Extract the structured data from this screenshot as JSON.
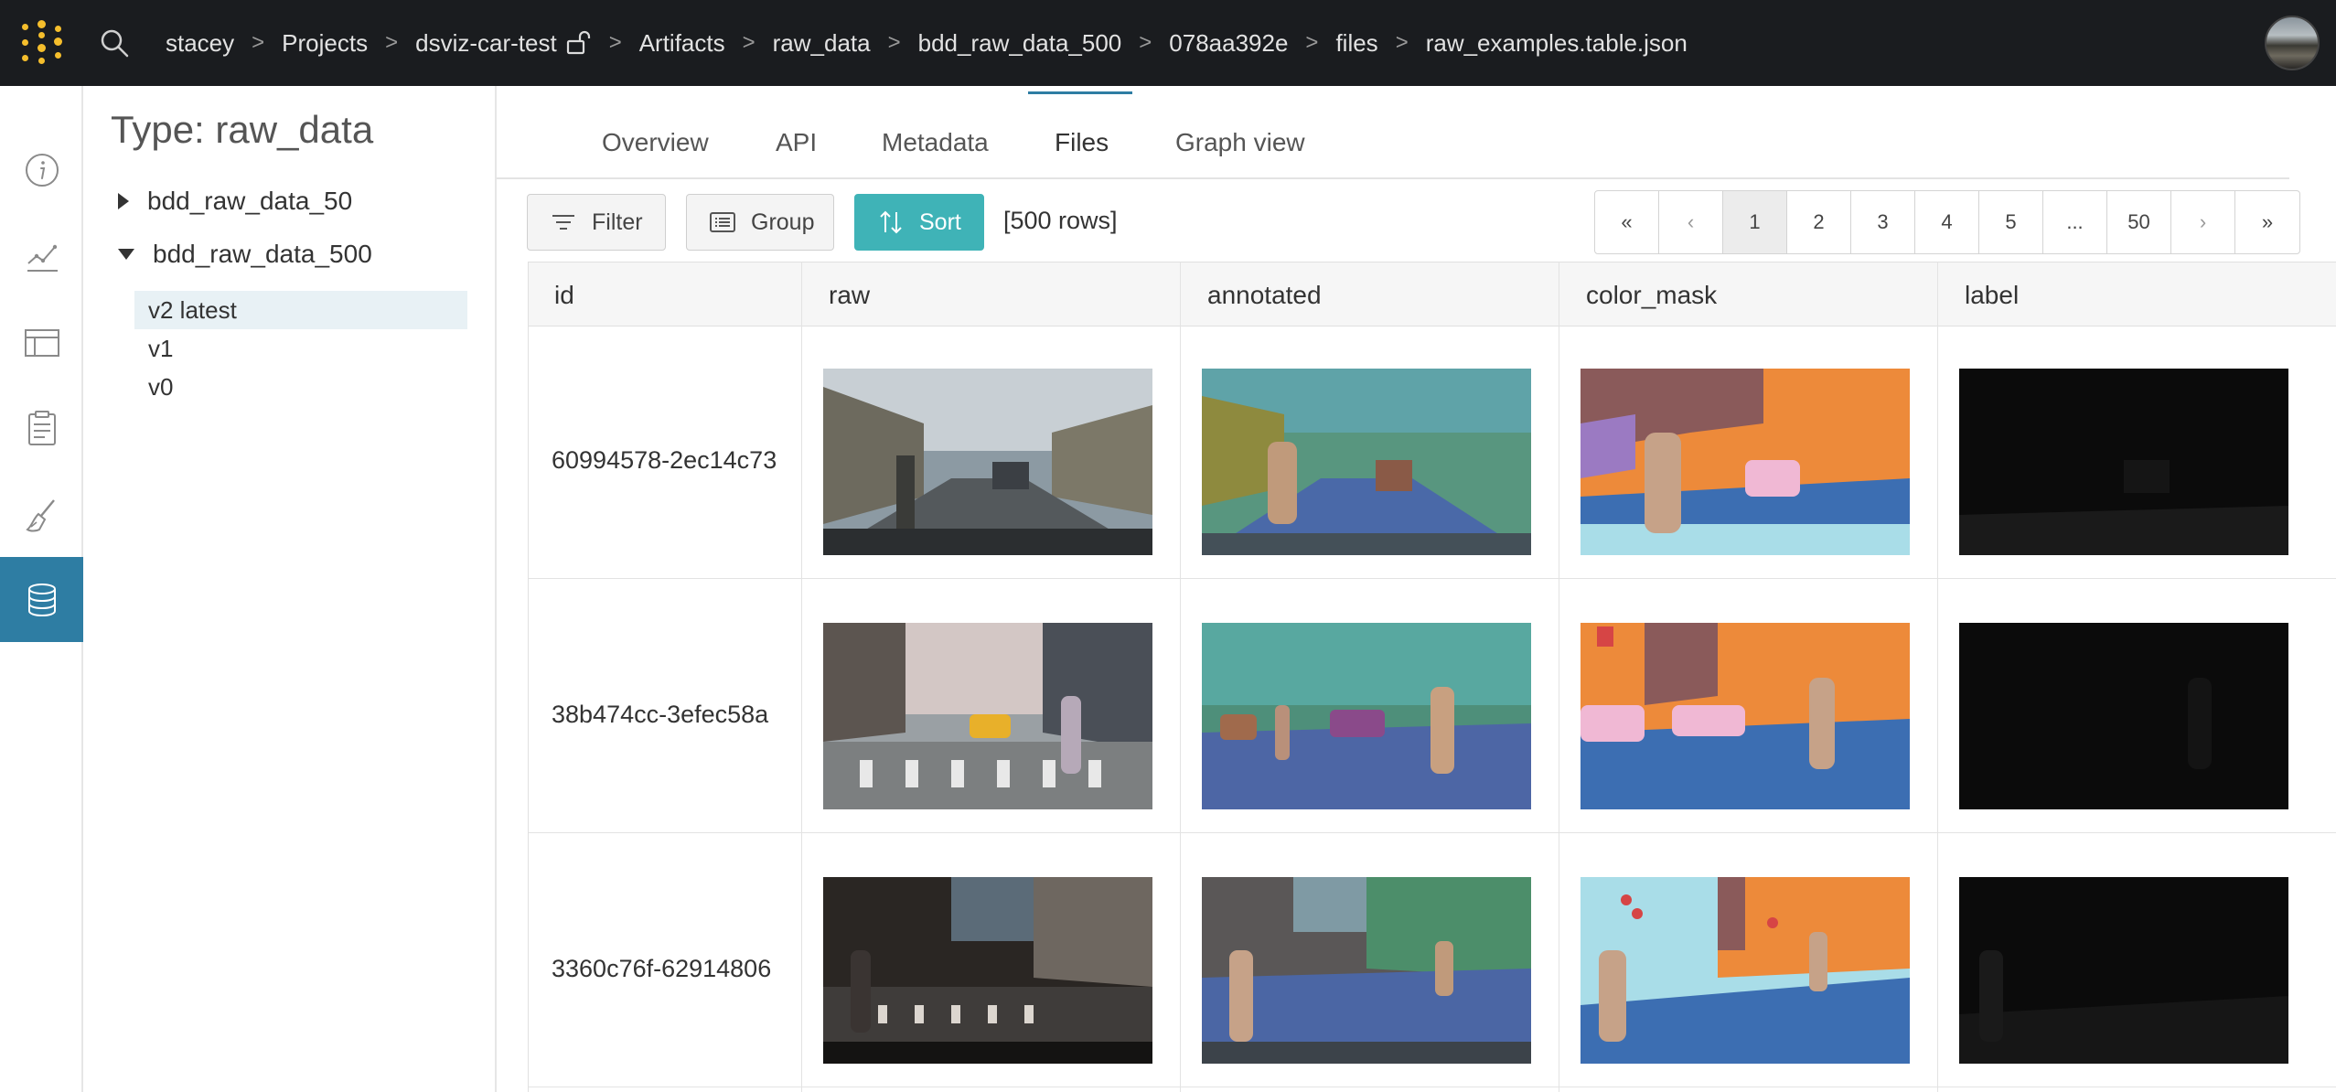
{
  "header": {
    "breadcrumbs": [
      "stacey",
      "Projects",
      "dsviz-car-test",
      "Artifacts",
      "raw_data",
      "bdd_raw_data_500",
      "078aa392e",
      "files",
      "raw_examples.table.json"
    ]
  },
  "sidebar_icons": [
    "info-icon",
    "chart-icon",
    "table-icon",
    "clipboard-icon",
    "sweep-brush-icon",
    "database-icon"
  ],
  "tree": {
    "title": "Type: raw_data",
    "nodes": [
      {
        "label": "bdd_raw_data_50",
        "expanded": false
      },
      {
        "label": "bdd_raw_data_500",
        "expanded": true
      }
    ],
    "versions": [
      "v2 latest",
      "v1",
      "v0"
    ]
  },
  "tabs": [
    "Overview",
    "API",
    "Metadata",
    "Files",
    "Graph view"
  ],
  "active_tab": "Files",
  "toolbar": {
    "filter_label": "Filter",
    "group_label": "Group",
    "sort_label": "Sort",
    "rows_count": "[500 rows]"
  },
  "pagination": [
    "«",
    "‹",
    "1",
    "2",
    "3",
    "4",
    "5",
    "...",
    "50",
    "›",
    "»"
  ],
  "current_page": "1",
  "table": {
    "columns": [
      "id",
      "raw",
      "annotated",
      "color_mask",
      "label"
    ],
    "rows": [
      {
        "id": "60994578-2ec14c73"
      },
      {
        "id": "38b474cc-3efec58a"
      },
      {
        "id": "3360c76f-62914806"
      }
    ]
  },
  "colors": {
    "accent": "#2e7da3",
    "sort_button": "#3fb3b7",
    "logo": "#f5be2c",
    "topbar": "#1a1c1f"
  }
}
